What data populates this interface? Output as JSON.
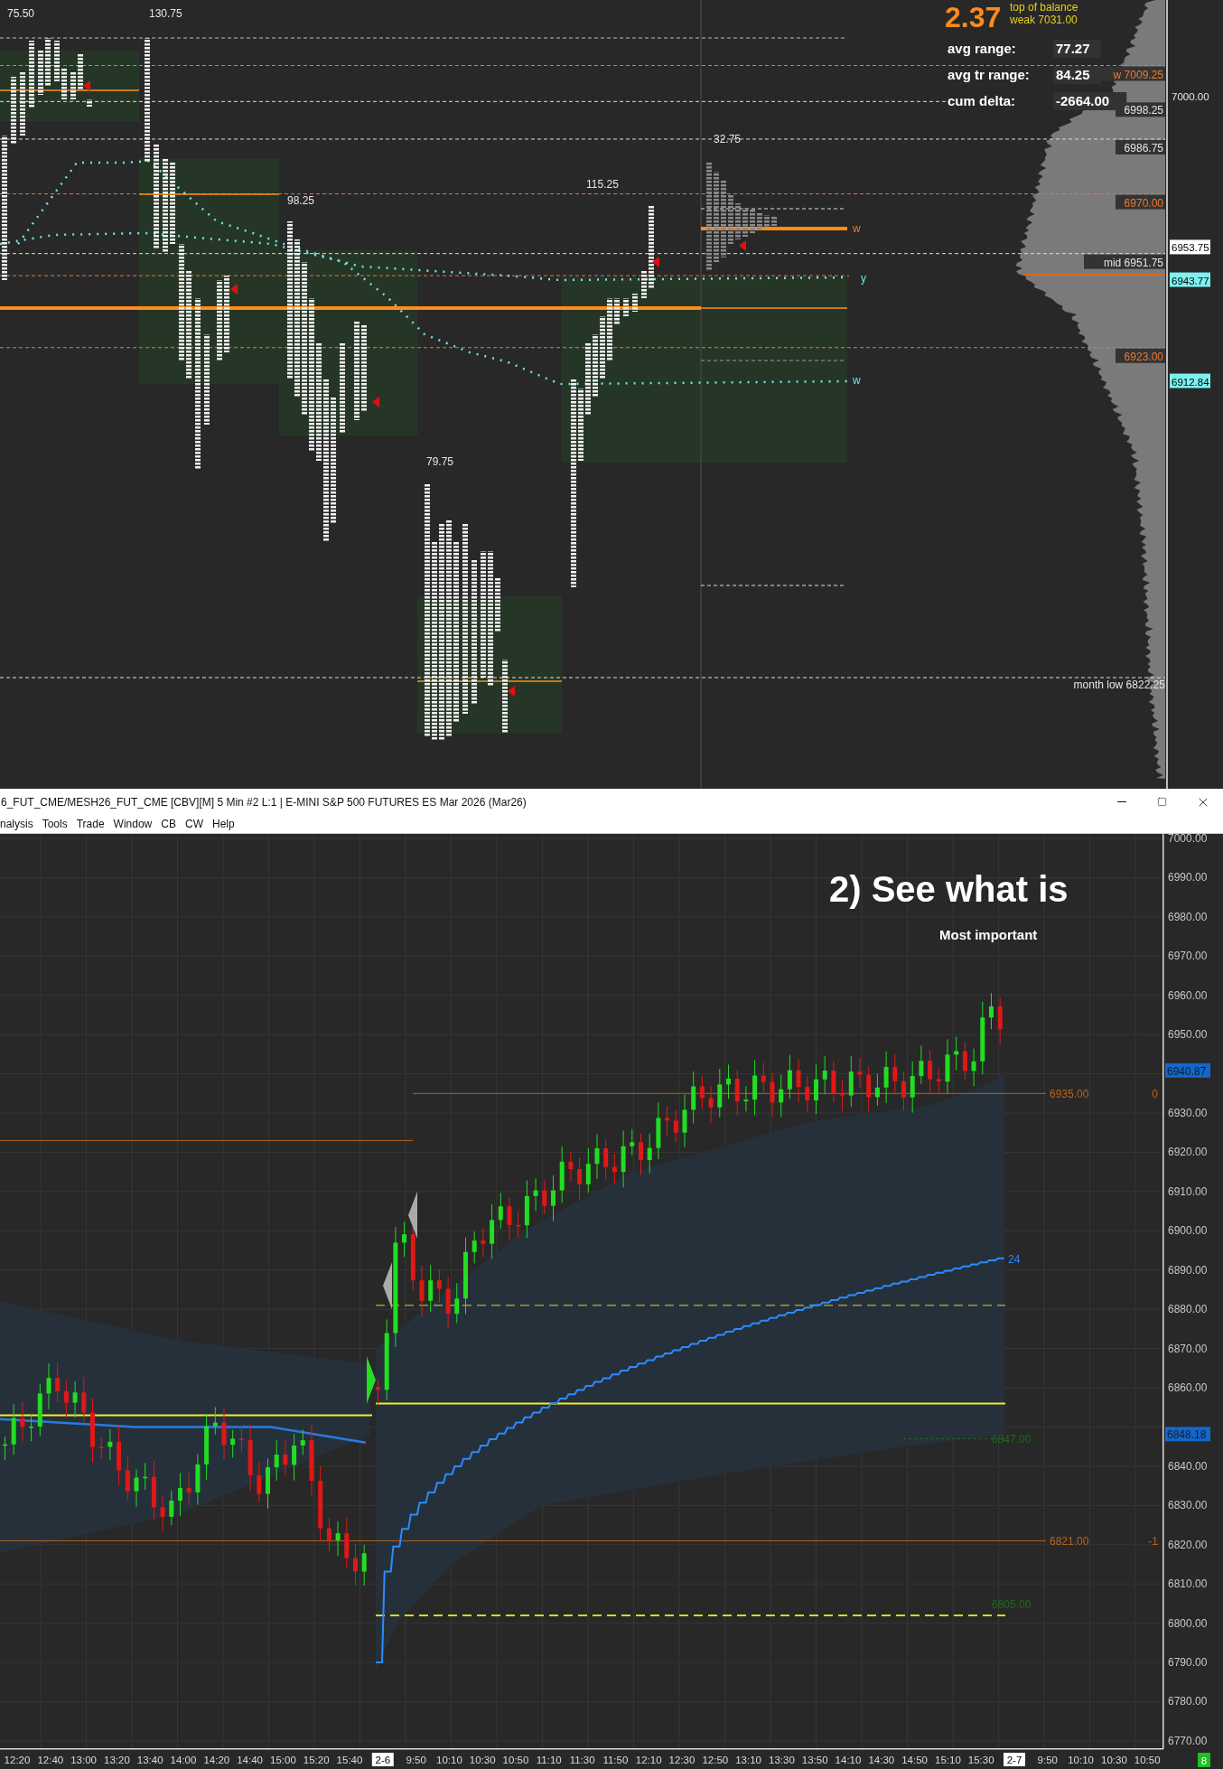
{
  "profile_chart": {
    "range_labels": [
      "75.50",
      "130.75",
      "98.25",
      "115.25",
      "79.75",
      "32.75"
    ],
    "big_value": "2.37",
    "balance_title": "top of balance",
    "balance_value": "weak  7031.00",
    "stats": [
      {
        "label": "avg range:",
        "value": "77.27"
      },
      {
        "label": "avg tr range:",
        "value": "84.25"
      },
      {
        "label": "cum delta:",
        "value": "-2664.00"
      }
    ],
    "level_tags": [
      {
        "text": "w  7009.25",
        "kind": "accent"
      },
      {
        "text": "6998.25",
        "kind": "plain"
      },
      {
        "text": "6986.75",
        "kind": "plain"
      },
      {
        "text": "6970.00",
        "kind": "accent"
      },
      {
        "text": "mid  6951.75",
        "kind": "plain"
      },
      {
        "text": "6923.00",
        "kind": "accent"
      }
    ],
    "axis_tags": [
      {
        "text": "7000.00",
        "kind": "plain"
      },
      {
        "text": "6953.75",
        "kind": "boxed"
      },
      {
        "text": "6943.77",
        "kind": "highlight"
      },
      {
        "text": "6912.84",
        "kind": "highlight"
      }
    ],
    "line_labels": [
      {
        "text": "w",
        "color": "#f07a30"
      },
      {
        "text": "y",
        "color": "#6ee6e6"
      },
      {
        "text": "w",
        "color": "#6ee6e6"
      }
    ],
    "month_low": "month low  6822.25"
  },
  "window": {
    "title": "6_FUT_CME/MESH26_FUT_CME [CBV][M]  5 Min  #2 L:1 | E-MINI S&P 500 FUTURES ES Mar 2026 (Mar26)",
    "menu": [
      "nalysis",
      "Tools",
      "Trade",
      "Window",
      "CB",
      "CW",
      "Help"
    ]
  },
  "chart": {
    "heading": "2)  See what is",
    "subheading": "Most important",
    "price_axis": [
      "7000.00",
      "6990.00",
      "6980.00",
      "6970.00",
      "6960.00",
      "6950.00",
      "6930.00",
      "6920.00",
      "6910.00",
      "6900.00",
      "6890.00",
      "6880.00",
      "6870.00",
      "6860.00",
      "6840.00",
      "6830.00",
      "6820.00",
      "6810.00",
      "6800.00",
      "6790.00",
      "6780.00",
      "6770.00"
    ],
    "price_tags": [
      "6940.87",
      "6848.18"
    ],
    "line_labels": [
      {
        "text": "6935.00",
        "color": "#b8651c"
      },
      {
        "text": "0",
        "color": "#b8651c"
      },
      {
        "text": "24",
        "color": "#2a8cff"
      },
      {
        "text": "6847.00",
        "color": "#1d6a1d"
      },
      {
        "text": "6821.00",
        "color": "#b8651c"
      },
      {
        "text": "-1",
        "color": "#b8651c"
      },
      {
        "text": "6805.00",
        "color": "#1d6a1d"
      }
    ],
    "time_axis": [
      {
        "text": "12:20",
        "kind": "time"
      },
      {
        "text": "12:40",
        "kind": "time"
      },
      {
        "text": "13:00",
        "kind": "time"
      },
      {
        "text": "13:20",
        "kind": "time"
      },
      {
        "text": "13:40",
        "kind": "time"
      },
      {
        "text": "14:00",
        "kind": "time"
      },
      {
        "text": "14:20",
        "kind": "time"
      },
      {
        "text": "14:40",
        "kind": "time"
      },
      {
        "text": "15:00",
        "kind": "time"
      },
      {
        "text": "15:20",
        "kind": "time"
      },
      {
        "text": "15:40",
        "kind": "time"
      },
      {
        "text": "2-6",
        "kind": "date"
      },
      {
        "text": "9:50",
        "kind": "time"
      },
      {
        "text": "10:10",
        "kind": "time"
      },
      {
        "text": "10:30",
        "kind": "time"
      },
      {
        "text": "10:50",
        "kind": "time"
      },
      {
        "text": "11:10",
        "kind": "time"
      },
      {
        "text": "11:30",
        "kind": "time"
      },
      {
        "text": "11:50",
        "kind": "time"
      },
      {
        "text": "12:10",
        "kind": "time"
      },
      {
        "text": "12:30",
        "kind": "time"
      },
      {
        "text": "12:50",
        "kind": "time"
      },
      {
        "text": "13:10",
        "kind": "time"
      },
      {
        "text": "13:30",
        "kind": "time"
      },
      {
        "text": "13:50",
        "kind": "time"
      },
      {
        "text": "14:10",
        "kind": "time"
      },
      {
        "text": "14:30",
        "kind": "time"
      },
      {
        "text": "14:50",
        "kind": "time"
      },
      {
        "text": "15:10",
        "kind": "time"
      },
      {
        "text": "15:30",
        "kind": "time"
      },
      {
        "text": "2-7",
        "kind": "date"
      },
      {
        "text": "9:50",
        "kind": "time"
      },
      {
        "text": "10:10",
        "kind": "time"
      },
      {
        "text": "10:30",
        "kind": "time"
      },
      {
        "text": "10:50",
        "kind": "time"
      }
    ],
    "bar_count": "8"
  }
}
